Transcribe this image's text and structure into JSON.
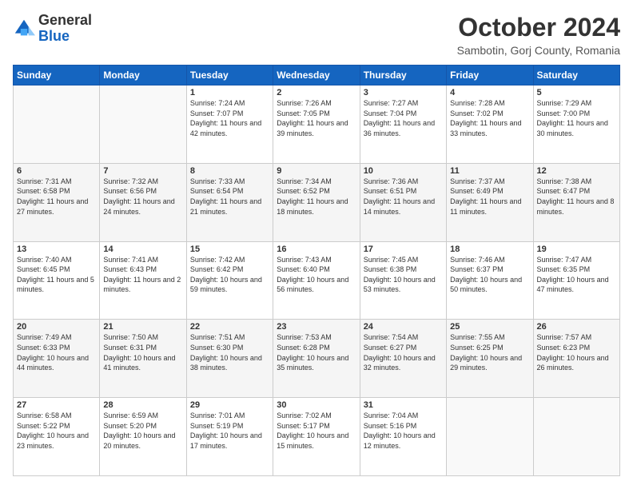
{
  "header": {
    "logo": {
      "general": "General",
      "blue": "Blue"
    },
    "title": "October 2024",
    "location": "Sambotin, Gorj County, Romania"
  },
  "days_of_week": [
    "Sunday",
    "Monday",
    "Tuesday",
    "Wednesday",
    "Thursday",
    "Friday",
    "Saturday"
  ],
  "weeks": [
    [
      {
        "day": "",
        "sunrise": "",
        "sunset": "",
        "daylight": ""
      },
      {
        "day": "",
        "sunrise": "",
        "sunset": "",
        "daylight": ""
      },
      {
        "day": "1",
        "sunrise": "Sunrise: 7:24 AM",
        "sunset": "Sunset: 7:07 PM",
        "daylight": "Daylight: 11 hours and 42 minutes."
      },
      {
        "day": "2",
        "sunrise": "Sunrise: 7:26 AM",
        "sunset": "Sunset: 7:05 PM",
        "daylight": "Daylight: 11 hours and 39 minutes."
      },
      {
        "day": "3",
        "sunrise": "Sunrise: 7:27 AM",
        "sunset": "Sunset: 7:04 PM",
        "daylight": "Daylight: 11 hours and 36 minutes."
      },
      {
        "day": "4",
        "sunrise": "Sunrise: 7:28 AM",
        "sunset": "Sunset: 7:02 PM",
        "daylight": "Daylight: 11 hours and 33 minutes."
      },
      {
        "day": "5",
        "sunrise": "Sunrise: 7:29 AM",
        "sunset": "Sunset: 7:00 PM",
        "daylight": "Daylight: 11 hours and 30 minutes."
      }
    ],
    [
      {
        "day": "6",
        "sunrise": "Sunrise: 7:31 AM",
        "sunset": "Sunset: 6:58 PM",
        "daylight": "Daylight: 11 hours and 27 minutes."
      },
      {
        "day": "7",
        "sunrise": "Sunrise: 7:32 AM",
        "sunset": "Sunset: 6:56 PM",
        "daylight": "Daylight: 11 hours and 24 minutes."
      },
      {
        "day": "8",
        "sunrise": "Sunrise: 7:33 AM",
        "sunset": "Sunset: 6:54 PM",
        "daylight": "Daylight: 11 hours and 21 minutes."
      },
      {
        "day": "9",
        "sunrise": "Sunrise: 7:34 AM",
        "sunset": "Sunset: 6:52 PM",
        "daylight": "Daylight: 11 hours and 18 minutes."
      },
      {
        "day": "10",
        "sunrise": "Sunrise: 7:36 AM",
        "sunset": "Sunset: 6:51 PM",
        "daylight": "Daylight: 11 hours and 14 minutes."
      },
      {
        "day": "11",
        "sunrise": "Sunrise: 7:37 AM",
        "sunset": "Sunset: 6:49 PM",
        "daylight": "Daylight: 11 hours and 11 minutes."
      },
      {
        "day": "12",
        "sunrise": "Sunrise: 7:38 AM",
        "sunset": "Sunset: 6:47 PM",
        "daylight": "Daylight: 11 hours and 8 minutes."
      }
    ],
    [
      {
        "day": "13",
        "sunrise": "Sunrise: 7:40 AM",
        "sunset": "Sunset: 6:45 PM",
        "daylight": "Daylight: 11 hours and 5 minutes."
      },
      {
        "day": "14",
        "sunrise": "Sunrise: 7:41 AM",
        "sunset": "Sunset: 6:43 PM",
        "daylight": "Daylight: 11 hours and 2 minutes."
      },
      {
        "day": "15",
        "sunrise": "Sunrise: 7:42 AM",
        "sunset": "Sunset: 6:42 PM",
        "daylight": "Daylight: 10 hours and 59 minutes."
      },
      {
        "day": "16",
        "sunrise": "Sunrise: 7:43 AM",
        "sunset": "Sunset: 6:40 PM",
        "daylight": "Daylight: 10 hours and 56 minutes."
      },
      {
        "day": "17",
        "sunrise": "Sunrise: 7:45 AM",
        "sunset": "Sunset: 6:38 PM",
        "daylight": "Daylight: 10 hours and 53 minutes."
      },
      {
        "day": "18",
        "sunrise": "Sunrise: 7:46 AM",
        "sunset": "Sunset: 6:37 PM",
        "daylight": "Daylight: 10 hours and 50 minutes."
      },
      {
        "day": "19",
        "sunrise": "Sunrise: 7:47 AM",
        "sunset": "Sunset: 6:35 PM",
        "daylight": "Daylight: 10 hours and 47 minutes."
      }
    ],
    [
      {
        "day": "20",
        "sunrise": "Sunrise: 7:49 AM",
        "sunset": "Sunset: 6:33 PM",
        "daylight": "Daylight: 10 hours and 44 minutes."
      },
      {
        "day": "21",
        "sunrise": "Sunrise: 7:50 AM",
        "sunset": "Sunset: 6:31 PM",
        "daylight": "Daylight: 10 hours and 41 minutes."
      },
      {
        "day": "22",
        "sunrise": "Sunrise: 7:51 AM",
        "sunset": "Sunset: 6:30 PM",
        "daylight": "Daylight: 10 hours and 38 minutes."
      },
      {
        "day": "23",
        "sunrise": "Sunrise: 7:53 AM",
        "sunset": "Sunset: 6:28 PM",
        "daylight": "Daylight: 10 hours and 35 minutes."
      },
      {
        "day": "24",
        "sunrise": "Sunrise: 7:54 AM",
        "sunset": "Sunset: 6:27 PM",
        "daylight": "Daylight: 10 hours and 32 minutes."
      },
      {
        "day": "25",
        "sunrise": "Sunrise: 7:55 AM",
        "sunset": "Sunset: 6:25 PM",
        "daylight": "Daylight: 10 hours and 29 minutes."
      },
      {
        "day": "26",
        "sunrise": "Sunrise: 7:57 AM",
        "sunset": "Sunset: 6:23 PM",
        "daylight": "Daylight: 10 hours and 26 minutes."
      }
    ],
    [
      {
        "day": "27",
        "sunrise": "Sunrise: 6:58 AM",
        "sunset": "Sunset: 5:22 PM",
        "daylight": "Daylight: 10 hours and 23 minutes."
      },
      {
        "day": "28",
        "sunrise": "Sunrise: 6:59 AM",
        "sunset": "Sunset: 5:20 PM",
        "daylight": "Daylight: 10 hours and 20 minutes."
      },
      {
        "day": "29",
        "sunrise": "Sunrise: 7:01 AM",
        "sunset": "Sunset: 5:19 PM",
        "daylight": "Daylight: 10 hours and 17 minutes."
      },
      {
        "day": "30",
        "sunrise": "Sunrise: 7:02 AM",
        "sunset": "Sunset: 5:17 PM",
        "daylight": "Daylight: 10 hours and 15 minutes."
      },
      {
        "day": "31",
        "sunrise": "Sunrise: 7:04 AM",
        "sunset": "Sunset: 5:16 PM",
        "daylight": "Daylight: 10 hours and 12 minutes."
      },
      {
        "day": "",
        "sunrise": "",
        "sunset": "",
        "daylight": ""
      },
      {
        "day": "",
        "sunrise": "",
        "sunset": "",
        "daylight": ""
      }
    ]
  ]
}
